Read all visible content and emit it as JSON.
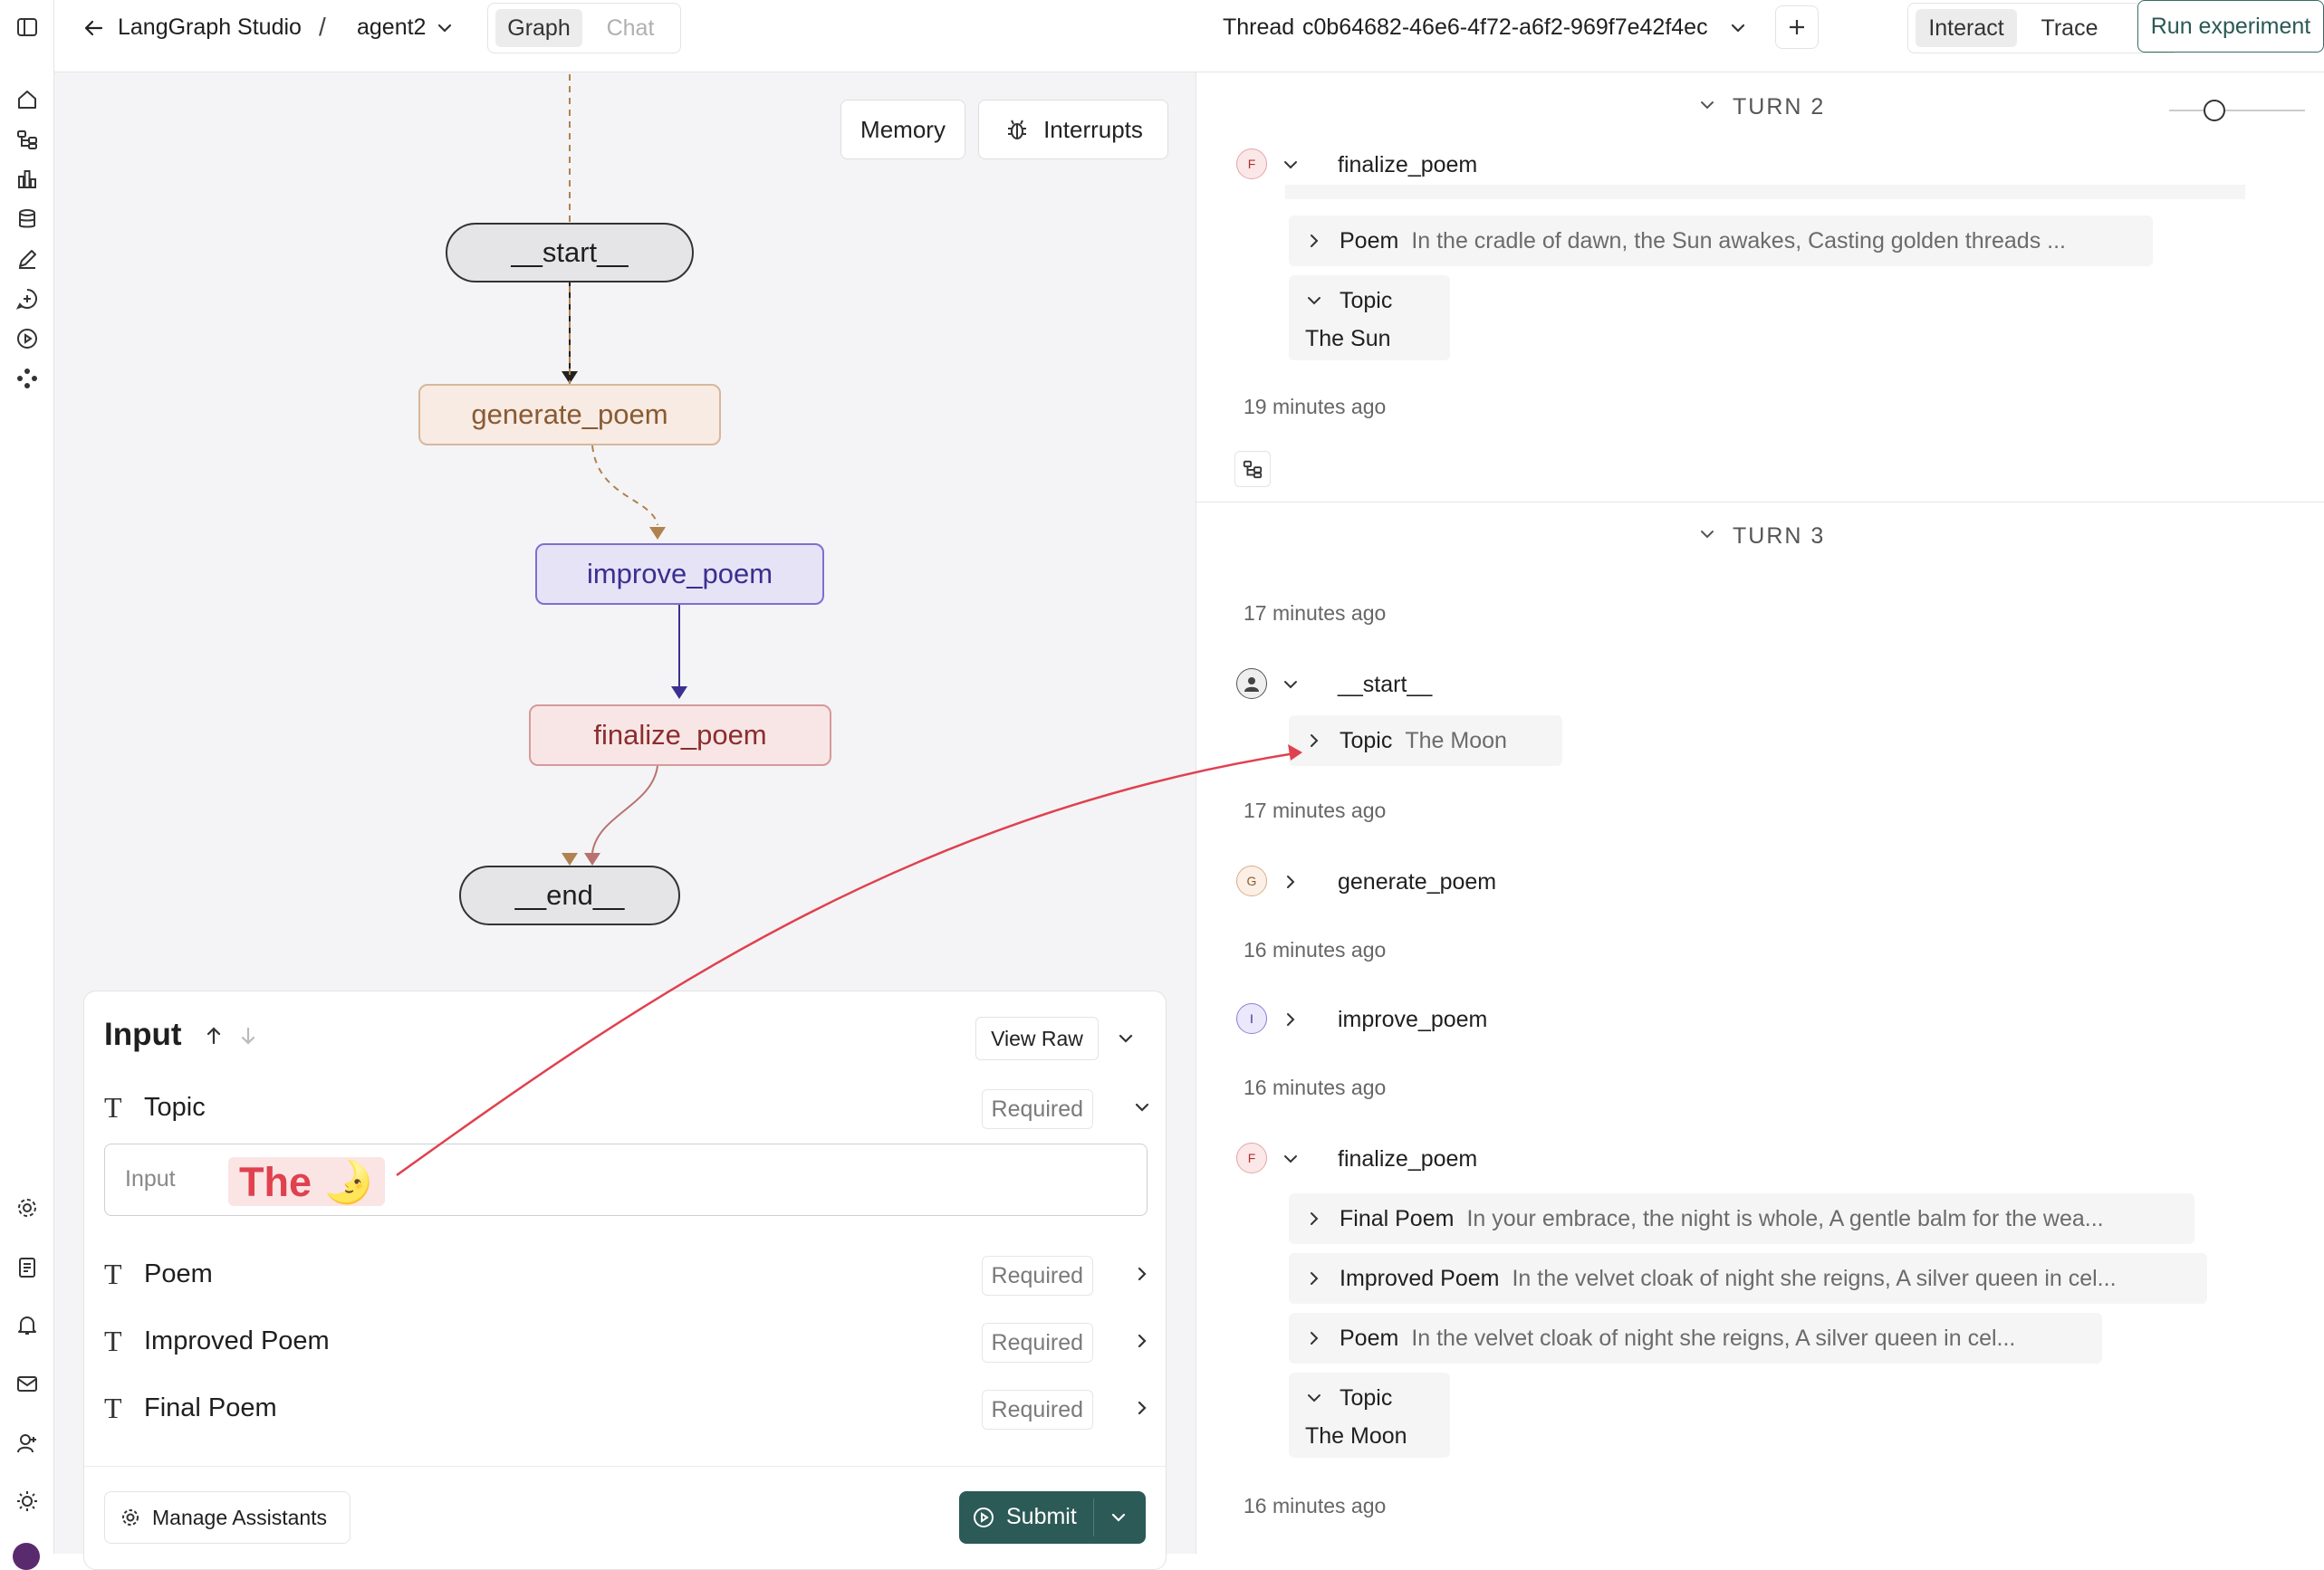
{
  "topbar": {
    "back_label": "LangGraph Studio",
    "separator": "/",
    "agent": "agent2",
    "view_tabs": [
      "Graph",
      "Chat"
    ],
    "active_view": "Graph",
    "thread_label": "Thread",
    "thread_id": "c0b64682-46e6-4f72-a6f2-969f7e42f4ec",
    "mode_tabs": [
      "Interact",
      "Trace"
    ],
    "active_mode": "Interact",
    "run_experiment": "Run experiment"
  },
  "canvas": {
    "memory_button": "Memory",
    "interrupts_button": "Interrupts",
    "nodes": {
      "start": "__start__",
      "generate": "generate_poem",
      "improve": "improve_poem",
      "finalize": "finalize_poem",
      "end": "__end__"
    },
    "colors": {
      "generate_bg": "#f7ebe3",
      "generate_border": "#d7b79c",
      "generate_text": "#8a5a33",
      "improve_bg": "#e6e3f7",
      "improve_border": "#7d6fd0",
      "improve_text": "#3b2f8f",
      "finalize_bg": "#f8e6e6",
      "finalize_border": "#d59a9a",
      "finalize_text": "#8b2e2e",
      "annotation_arrow": "#e0414f"
    }
  },
  "input_panel": {
    "title": "Input",
    "view_raw": "View Raw",
    "fields": [
      {
        "label": "Topic",
        "badge": "Required"
      },
      {
        "label": "Poem",
        "badge": "Required"
      },
      {
        "label": "Improved Poem",
        "badge": "Required"
      },
      {
        "label": "Final Poem",
        "badge": "Required"
      }
    ],
    "topic_placeholder": "Input",
    "typed_text": "The 🌛",
    "manage_assistants": "Manage Assistants",
    "submit": "Submit"
  },
  "thread": {
    "turn2": {
      "label": "TURN 2",
      "node": {
        "avatar": "F",
        "name": "finalize_poem"
      },
      "poem_key": "Poem",
      "poem_value": "In the cradle of dawn, the Sun awakes, Casting golden threads ...",
      "topic_key": "Topic",
      "topic_value": "The Sun",
      "timestamp": "19 minutes ago"
    },
    "turn3": {
      "label": "TURN 3",
      "ts1": "17 minutes ago",
      "start": {
        "name": "__start__",
        "topic_key": "Topic",
        "topic_value": "The Moon"
      },
      "ts2": "17 minutes ago",
      "generate": {
        "avatar": "G",
        "name": "generate_poem"
      },
      "ts3": "16 minutes ago",
      "improve": {
        "avatar": "I",
        "name": "improve_poem"
      },
      "ts4": "16 minutes ago",
      "finalize": {
        "avatar": "F",
        "name": "finalize_poem",
        "final_key": "Final Poem",
        "final_value": "In your embrace, the night is whole, A gentle balm for the wea...",
        "improved_key": "Improved Poem",
        "improved_value": "In the velvet cloak of night she reigns, A silver queen in cel...",
        "poem_key": "Poem",
        "poem_value": "In the velvet cloak of night she reigns, A silver queen in cel...",
        "topic_key": "Topic",
        "topic_value": "The Moon"
      },
      "ts5": "16 minutes ago"
    }
  }
}
